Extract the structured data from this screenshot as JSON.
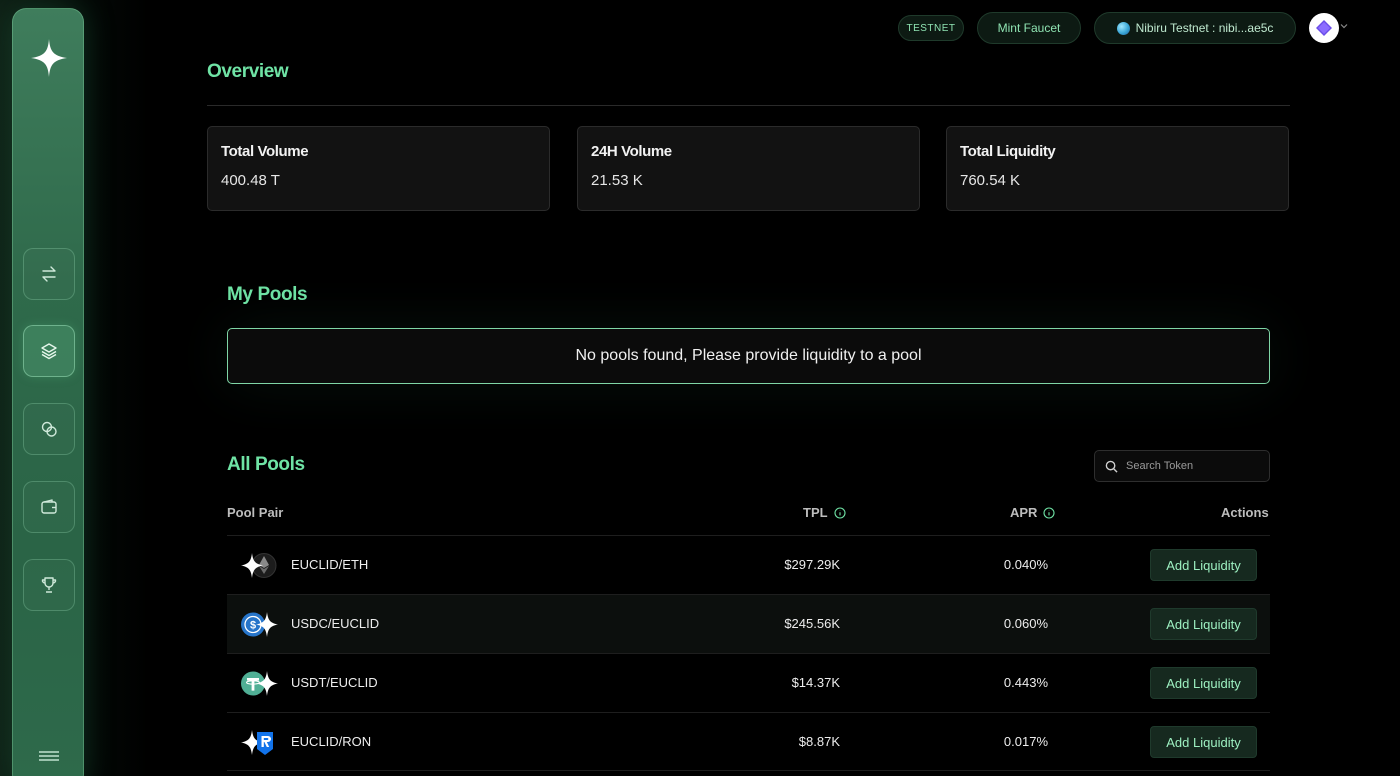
{
  "topbar": {
    "network_badge": "TESTNET",
    "mint_faucet": "Mint Faucet",
    "wallet": "Nibiru Testnet : nibi...ae5c"
  },
  "sidebar": {
    "items": [
      {
        "name": "swap",
        "icon": "swap-arrows-icon"
      },
      {
        "name": "pools",
        "icon": "layers-icon",
        "active": true
      },
      {
        "name": "tokens",
        "icon": "coins-icon"
      },
      {
        "name": "wallet",
        "icon": "wallet-icon"
      },
      {
        "name": "rewards",
        "icon": "trophy-icon"
      }
    ],
    "menu_icon": "menu-icon"
  },
  "overview": {
    "title": "Overview",
    "cards": [
      {
        "label": "Total Volume",
        "value": "400.48 T"
      },
      {
        "label": "24H Volume",
        "value": "21.53 K"
      },
      {
        "label": "Total Liquidity",
        "value": "760.54 K"
      }
    ]
  },
  "my_pools": {
    "title": "My Pools",
    "empty_message": "No pools found, Please provide liquidity to a pool"
  },
  "all_pools": {
    "title": "All Pools",
    "search_placeholder": "Search Token",
    "columns": {
      "pair": "Pool Pair",
      "tpl": "TPL",
      "apr": "APR",
      "actions": "Actions"
    },
    "rows": [
      {
        "pair": "EUCLID/ETH",
        "tpl": "$297.29K",
        "apr": "0.040%",
        "action": "Add Liquidity",
        "icon": "euclid-eth-icon"
      },
      {
        "pair": "USDC/EUCLID",
        "tpl": "$245.56K",
        "apr": "0.060%",
        "action": "Add Liquidity",
        "icon": "usdc-euclid-icon"
      },
      {
        "pair": "USDT/EUCLID",
        "tpl": "$14.37K",
        "apr": "0.443%",
        "action": "Add Liquidity",
        "icon": "usdt-euclid-icon"
      },
      {
        "pair": "EUCLID/RON",
        "tpl": "$8.87K",
        "apr": "0.017%",
        "action": "Add Liquidity",
        "icon": "euclid-ron-icon"
      }
    ]
  },
  "colors": {
    "accent": "#6fe3a5",
    "sidebar": "#2f6a4b",
    "button_bg": "#16291f"
  }
}
